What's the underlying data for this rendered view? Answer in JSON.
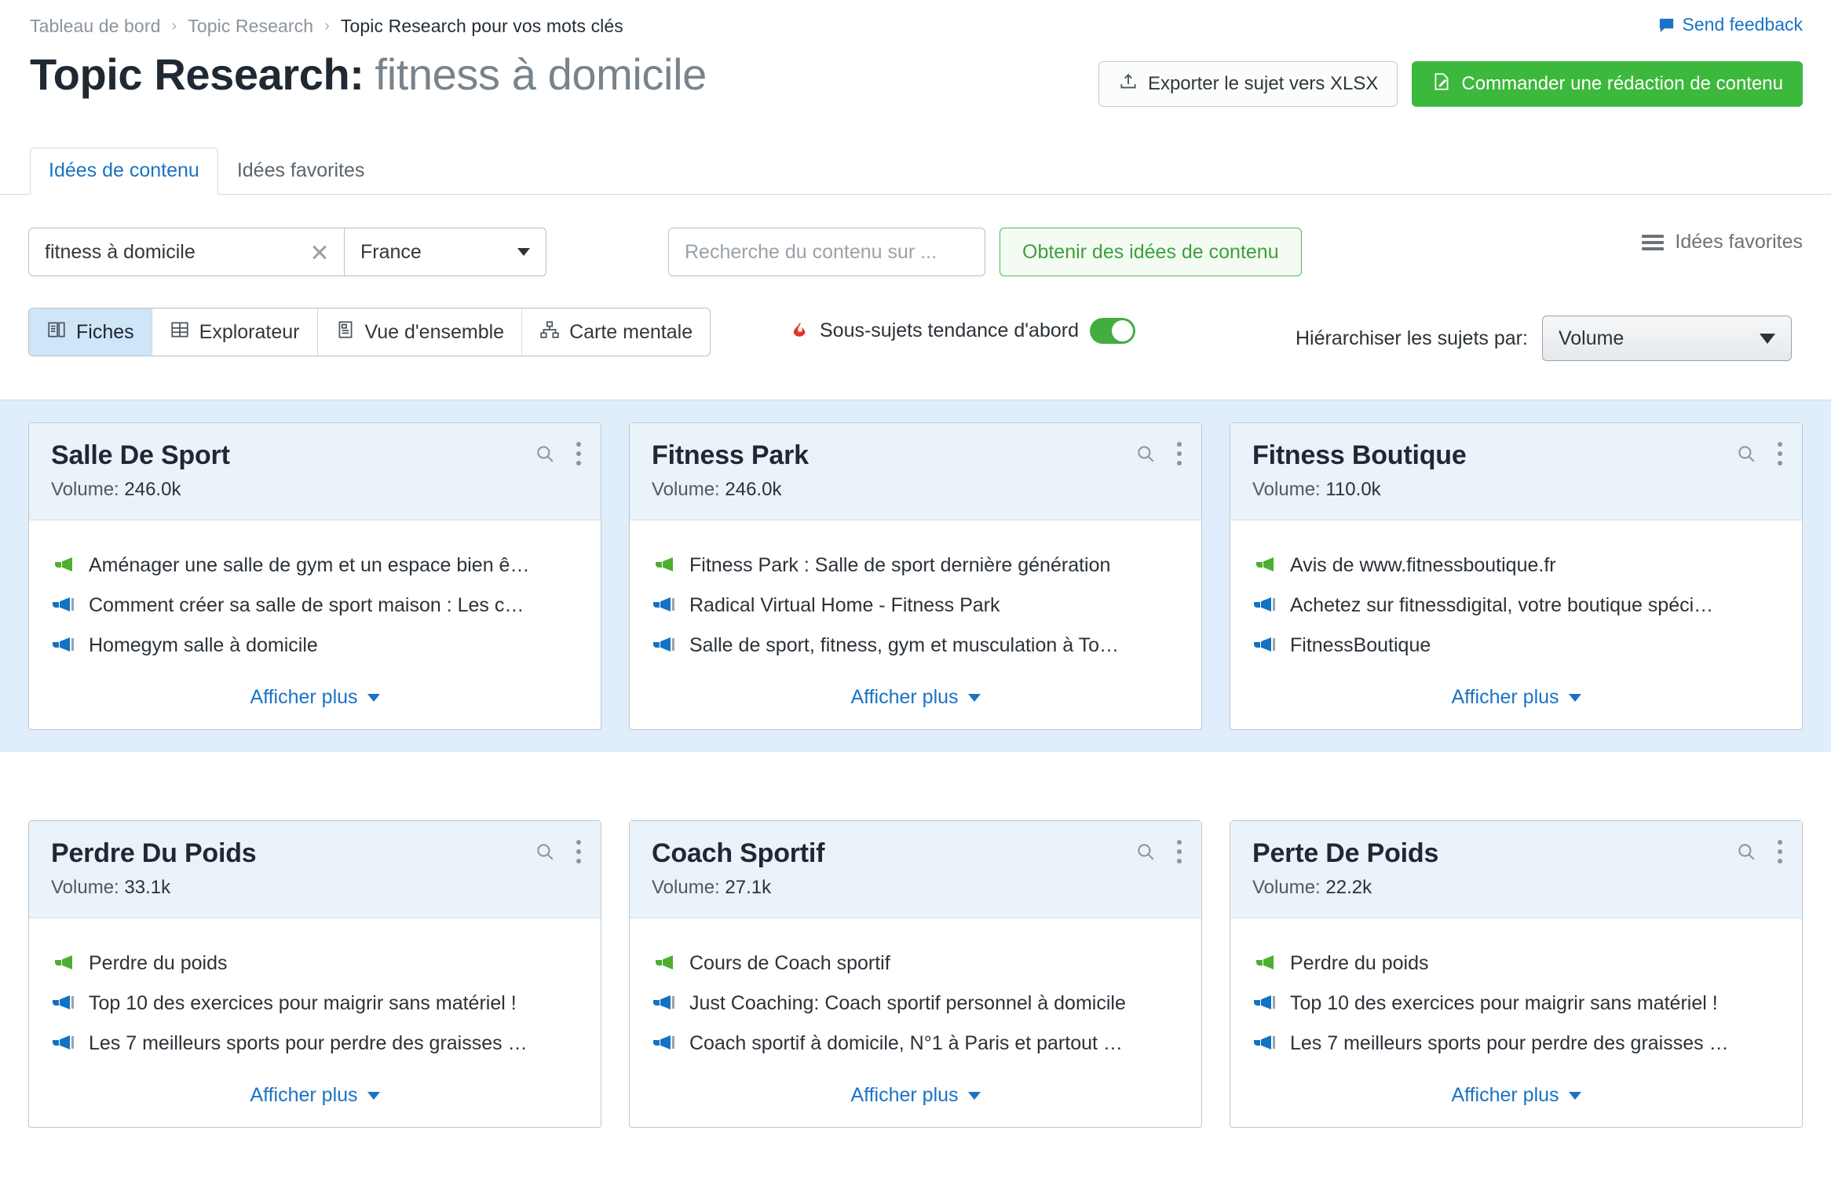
{
  "breadcrumb": {
    "items": [
      "Tableau de bord",
      "Topic Research",
      "Topic Research pour vos mots clés"
    ],
    "separator": "›"
  },
  "feedback": {
    "label": "Send feedback",
    "icon": "speech-bubble-icon",
    "color": "#1a73c4"
  },
  "header": {
    "title_main": "Topic Research:",
    "title_keyword": "fitness à domicile",
    "export_label": "Exporter le sujet vers XLSX",
    "export_icon": "upload-icon",
    "order_label": "Commander une rédaction de contenu",
    "order_icon": "edit-document-icon",
    "order_color": "#3cb83c"
  },
  "tabs": [
    {
      "label": "Idées de contenu",
      "active": true
    },
    {
      "label": "Idées favorites",
      "active": false
    }
  ],
  "search": {
    "keyword_value": "fitness à domicile",
    "clear_icon": "close-icon",
    "country_value": "France",
    "country_chevron": "chevron-down-icon",
    "domain_placeholder": "Recherche du contenu sur ...",
    "get_ideas_label": "Obtenir des idées de contenu",
    "favorites_label": "Idées favorites",
    "favorites_icon": "list-icon"
  },
  "toolbar": {
    "views": [
      {
        "label": "Fiches",
        "icon": "cards-icon",
        "active": true
      },
      {
        "label": "Explorateur",
        "icon": "grid-icon",
        "active": false
      },
      {
        "label": "Vue d'ensemble",
        "icon": "overview-icon",
        "active": false
      },
      {
        "label": "Carte mentale",
        "icon": "mindmap-icon",
        "active": false
      }
    ],
    "trending_label": "Sous-sujets tendance d'abord",
    "trending_icon": "flame-icon",
    "trending_on": true,
    "trending_color": "#43ad42",
    "hierarchy_label": "Hiérarchiser les sujets par:",
    "hierarchy_value": "Volume"
  },
  "cards": {
    "show_more_label": "Afficher plus",
    "volume_label": "Volume:",
    "search_icon": "magnifier-icon",
    "menu_icon": "kebab-menu-icon",
    "rows": [
      {
        "highlighted": true,
        "items": [
          {
            "title": "Salle De Sport",
            "volume": "246.0k",
            "ideas": [
              {
                "text": "Aménager une salle de gym et un espace bien ê…",
                "icon": "megaphone-green-icon"
              },
              {
                "text": "Comment créer sa salle de sport maison : Les c…",
                "icon": "megaphone-blue-icon"
              },
              {
                "text": "Homegym salle à domicile",
                "icon": "megaphone-blue-icon"
              }
            ]
          },
          {
            "title": "Fitness Park",
            "volume": "246.0k",
            "ideas": [
              {
                "text": "Fitness Park : Salle de sport dernière génération",
                "icon": "megaphone-green-icon"
              },
              {
                "text": "Radical Virtual Home - Fitness Park",
                "icon": "megaphone-blue-icon"
              },
              {
                "text": "Salle de sport, fitness, gym et musculation à To…",
                "icon": "megaphone-blue-icon"
              }
            ]
          },
          {
            "title": "Fitness Boutique",
            "volume": "110.0k",
            "ideas": [
              {
                "text": "Avis de www.fitnessboutique.fr",
                "icon": "megaphone-green-icon"
              },
              {
                "text": "Achetez sur fitnessdigital, votre boutique spéci…",
                "icon": "megaphone-blue-icon"
              },
              {
                "text": "FitnessBoutique",
                "icon": "megaphone-blue-icon"
              }
            ]
          }
        ]
      },
      {
        "highlighted": false,
        "items": [
          {
            "title": "Perdre Du Poids",
            "volume": "33.1k",
            "ideas": [
              {
                "text": "Perdre du poids",
                "icon": "megaphone-green-icon"
              },
              {
                "text": "Top 10 des exercices pour maigrir sans matériel !",
                "icon": "megaphone-blue-icon"
              },
              {
                "text": "Les 7 meilleurs sports pour perdre des graisses …",
                "icon": "megaphone-blue-icon"
              }
            ]
          },
          {
            "title": "Coach Sportif",
            "volume": "27.1k",
            "ideas": [
              {
                "text": "Cours de Coach sportif",
                "icon": "megaphone-green-icon"
              },
              {
                "text": "Just Coaching: Coach sportif personnel à domicile",
                "icon": "megaphone-blue-icon"
              },
              {
                "text": "Coach sportif à domicile, N°1 à Paris et partout …",
                "icon": "megaphone-blue-icon"
              }
            ]
          },
          {
            "title": "Perte De Poids",
            "volume": "22.2k",
            "ideas": [
              {
                "text": "Perdre du poids",
                "icon": "megaphone-green-icon"
              },
              {
                "text": "Top 10 des exercices pour maigrir sans matériel !",
                "icon": "megaphone-blue-icon"
              },
              {
                "text": "Les 7 meilleurs sports pour perdre des graisses …",
                "icon": "megaphone-blue-icon"
              }
            ]
          }
        ]
      }
    ]
  },
  "colors": {
    "accent_blue": "#1a73c4",
    "accent_green": "#3cb83c",
    "megaphone_green": "#4caf2f",
    "megaphone_blue": "#1272c4",
    "row_highlight": "#e0eefb",
    "card_header": "#eaf2fa"
  }
}
